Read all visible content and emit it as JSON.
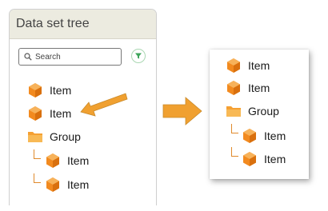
{
  "panel": {
    "title": "Data set tree",
    "search_placeholder": "Search",
    "filter_icon": "filter-icon",
    "tree": [
      {
        "label": "Item",
        "icon": "cube-icon",
        "type": "item"
      },
      {
        "label": "Item",
        "icon": "cube-icon",
        "type": "item"
      },
      {
        "label": "Group",
        "icon": "folder-icon",
        "type": "group"
      },
      {
        "label": "Item",
        "icon": "cube-icon",
        "type": "child"
      },
      {
        "label": "Item",
        "icon": "cube-icon",
        "type": "child"
      }
    ]
  },
  "card": {
    "tree": [
      {
        "label": "Item",
        "icon": "cube-icon",
        "type": "item"
      },
      {
        "label": "Item",
        "icon": "cube-icon",
        "type": "item"
      },
      {
        "label": "Group",
        "icon": "folder-icon",
        "type": "group"
      },
      {
        "label": "Item",
        "icon": "cube-icon",
        "type": "child"
      },
      {
        "label": "Item",
        "icon": "cube-icon",
        "type": "child"
      }
    ]
  },
  "colors": {
    "accent_orange": "#f0a030",
    "cube_orange": "#f28a1f",
    "folder_orange": "#f5a033",
    "filter_green": "#3da45a",
    "header_bg": "#ecebe0"
  }
}
